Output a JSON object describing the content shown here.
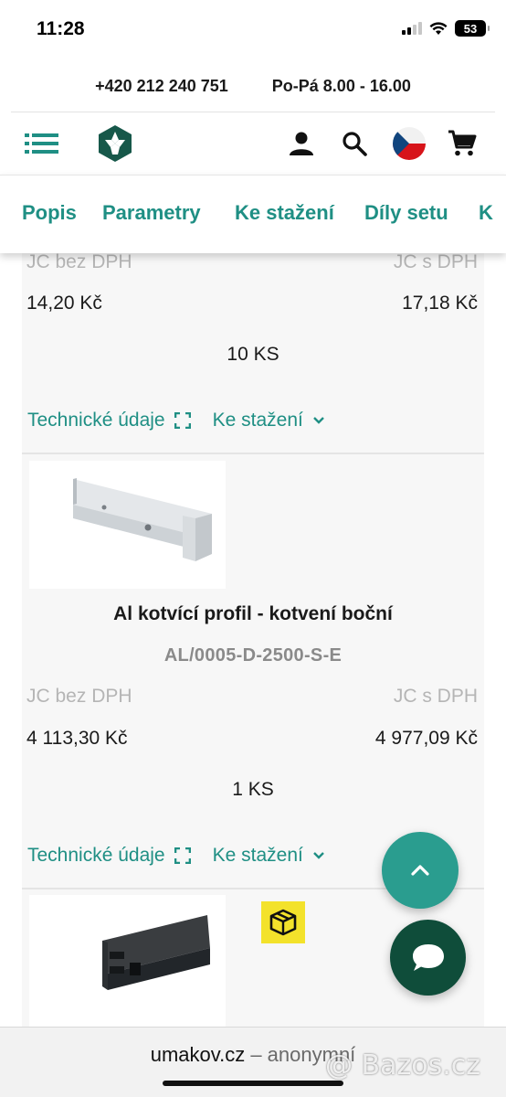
{
  "status_bar": {
    "time": "11:28",
    "battery": "53"
  },
  "contact": {
    "phone": "+420 212 240 751",
    "hours": "Po-Pá 8.00 - 16.00"
  },
  "tabs": [
    {
      "label": "Popis"
    },
    {
      "label": "Parametry"
    },
    {
      "label": "Ke stažení"
    },
    {
      "label": "Díly setu"
    },
    {
      "label": "K"
    }
  ],
  "product_prev": {
    "price_head_net": "JC bez DPH",
    "price_head_gross": "JC s DPH",
    "price_net": "14,20 Kč",
    "price_gross": "17,18 Kč",
    "quantity": "10 KS",
    "tech_link": "Technické údaje",
    "download_link": "Ke stažení"
  },
  "product_main": {
    "title": "Al kotvící profil - kotvení boční",
    "code": "AL/0005-D-2500-S-E",
    "price_head_net": "JC bez DPH",
    "price_head_gross": "JC s DPH",
    "price_net": "4 113,30 Kč",
    "price_gross": "4 977,09 Kč",
    "quantity": "1 KS",
    "tech_link": "Technické údaje",
    "download_link": "Ke stažení"
  },
  "url_bar": {
    "domain": "umakov.cz",
    "rest": " – anonymní"
  },
  "watermark": "@ Bazos.cz",
  "colors": {
    "accent": "#1f8f84",
    "fab_up": "#2a9d8f",
    "fab_chat": "#0f4d3a",
    "badge": "#f3e22b"
  },
  "icons": [
    "menu-icon",
    "logo-icon",
    "user-icon",
    "search-icon",
    "flag-cz-icon",
    "cart-icon",
    "expand-icon",
    "chevron-down-icon",
    "chevron-up-icon",
    "chat-icon",
    "box-icon"
  ]
}
